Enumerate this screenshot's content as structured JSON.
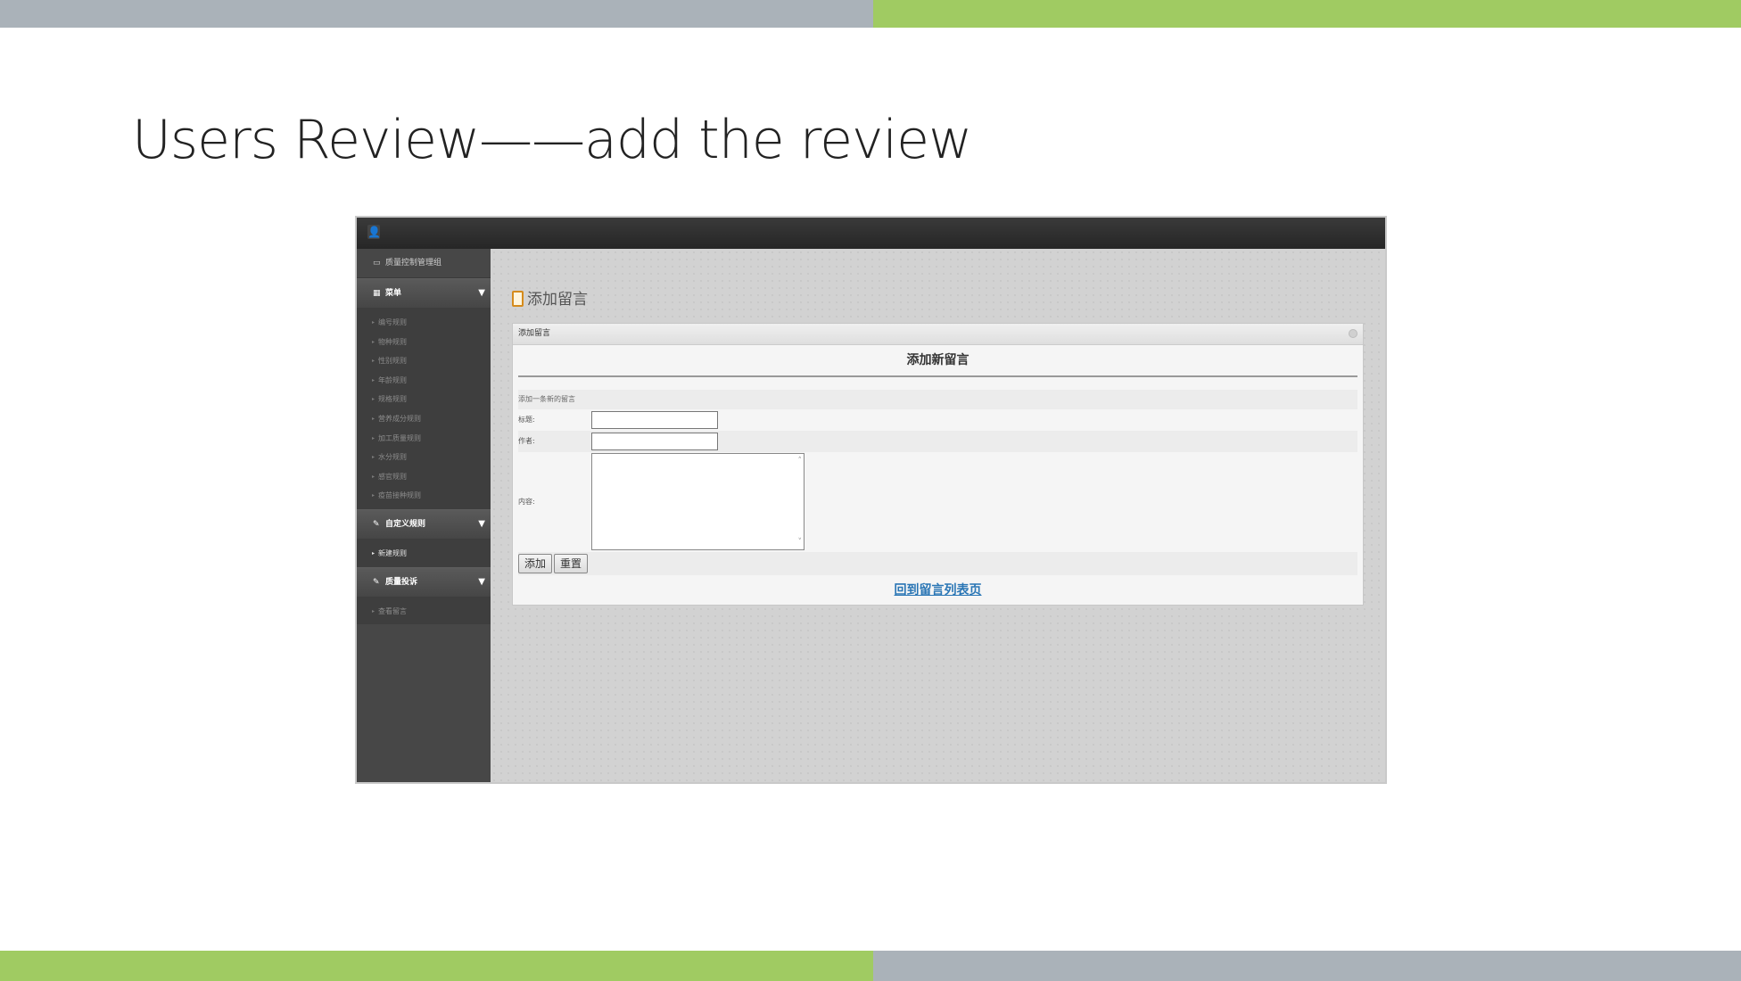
{
  "slide": {
    "title": "Users Review——add the review"
  },
  "app": {
    "brand": "质量控制管理组",
    "menus": [
      {
        "label": "菜单",
        "items": [
          "编号规则",
          "物种规则",
          "性别规则",
          "年龄规则",
          "规格规则",
          "营养成分规则",
          "加工质量规则",
          "水分规则",
          "感官规则",
          "疫苗接种规则"
        ]
      },
      {
        "label": "自定义规则",
        "items": [
          "新建规则"
        ]
      },
      {
        "label": "质量投诉",
        "items": [
          "查看留言"
        ]
      }
    ]
  },
  "page": {
    "heading": "添加留言",
    "panel_title": "添加留言",
    "form_title": "添加新留言",
    "form_subtitle": "添加一条新的留言",
    "fields": {
      "title_label": "标题:",
      "author_label": "作者:",
      "content_label": "内容:",
      "title_value": "",
      "author_value": "",
      "content_value": ""
    },
    "buttons": {
      "add": "添加",
      "reset": "重置"
    },
    "back_link": "回到留言列表页"
  }
}
